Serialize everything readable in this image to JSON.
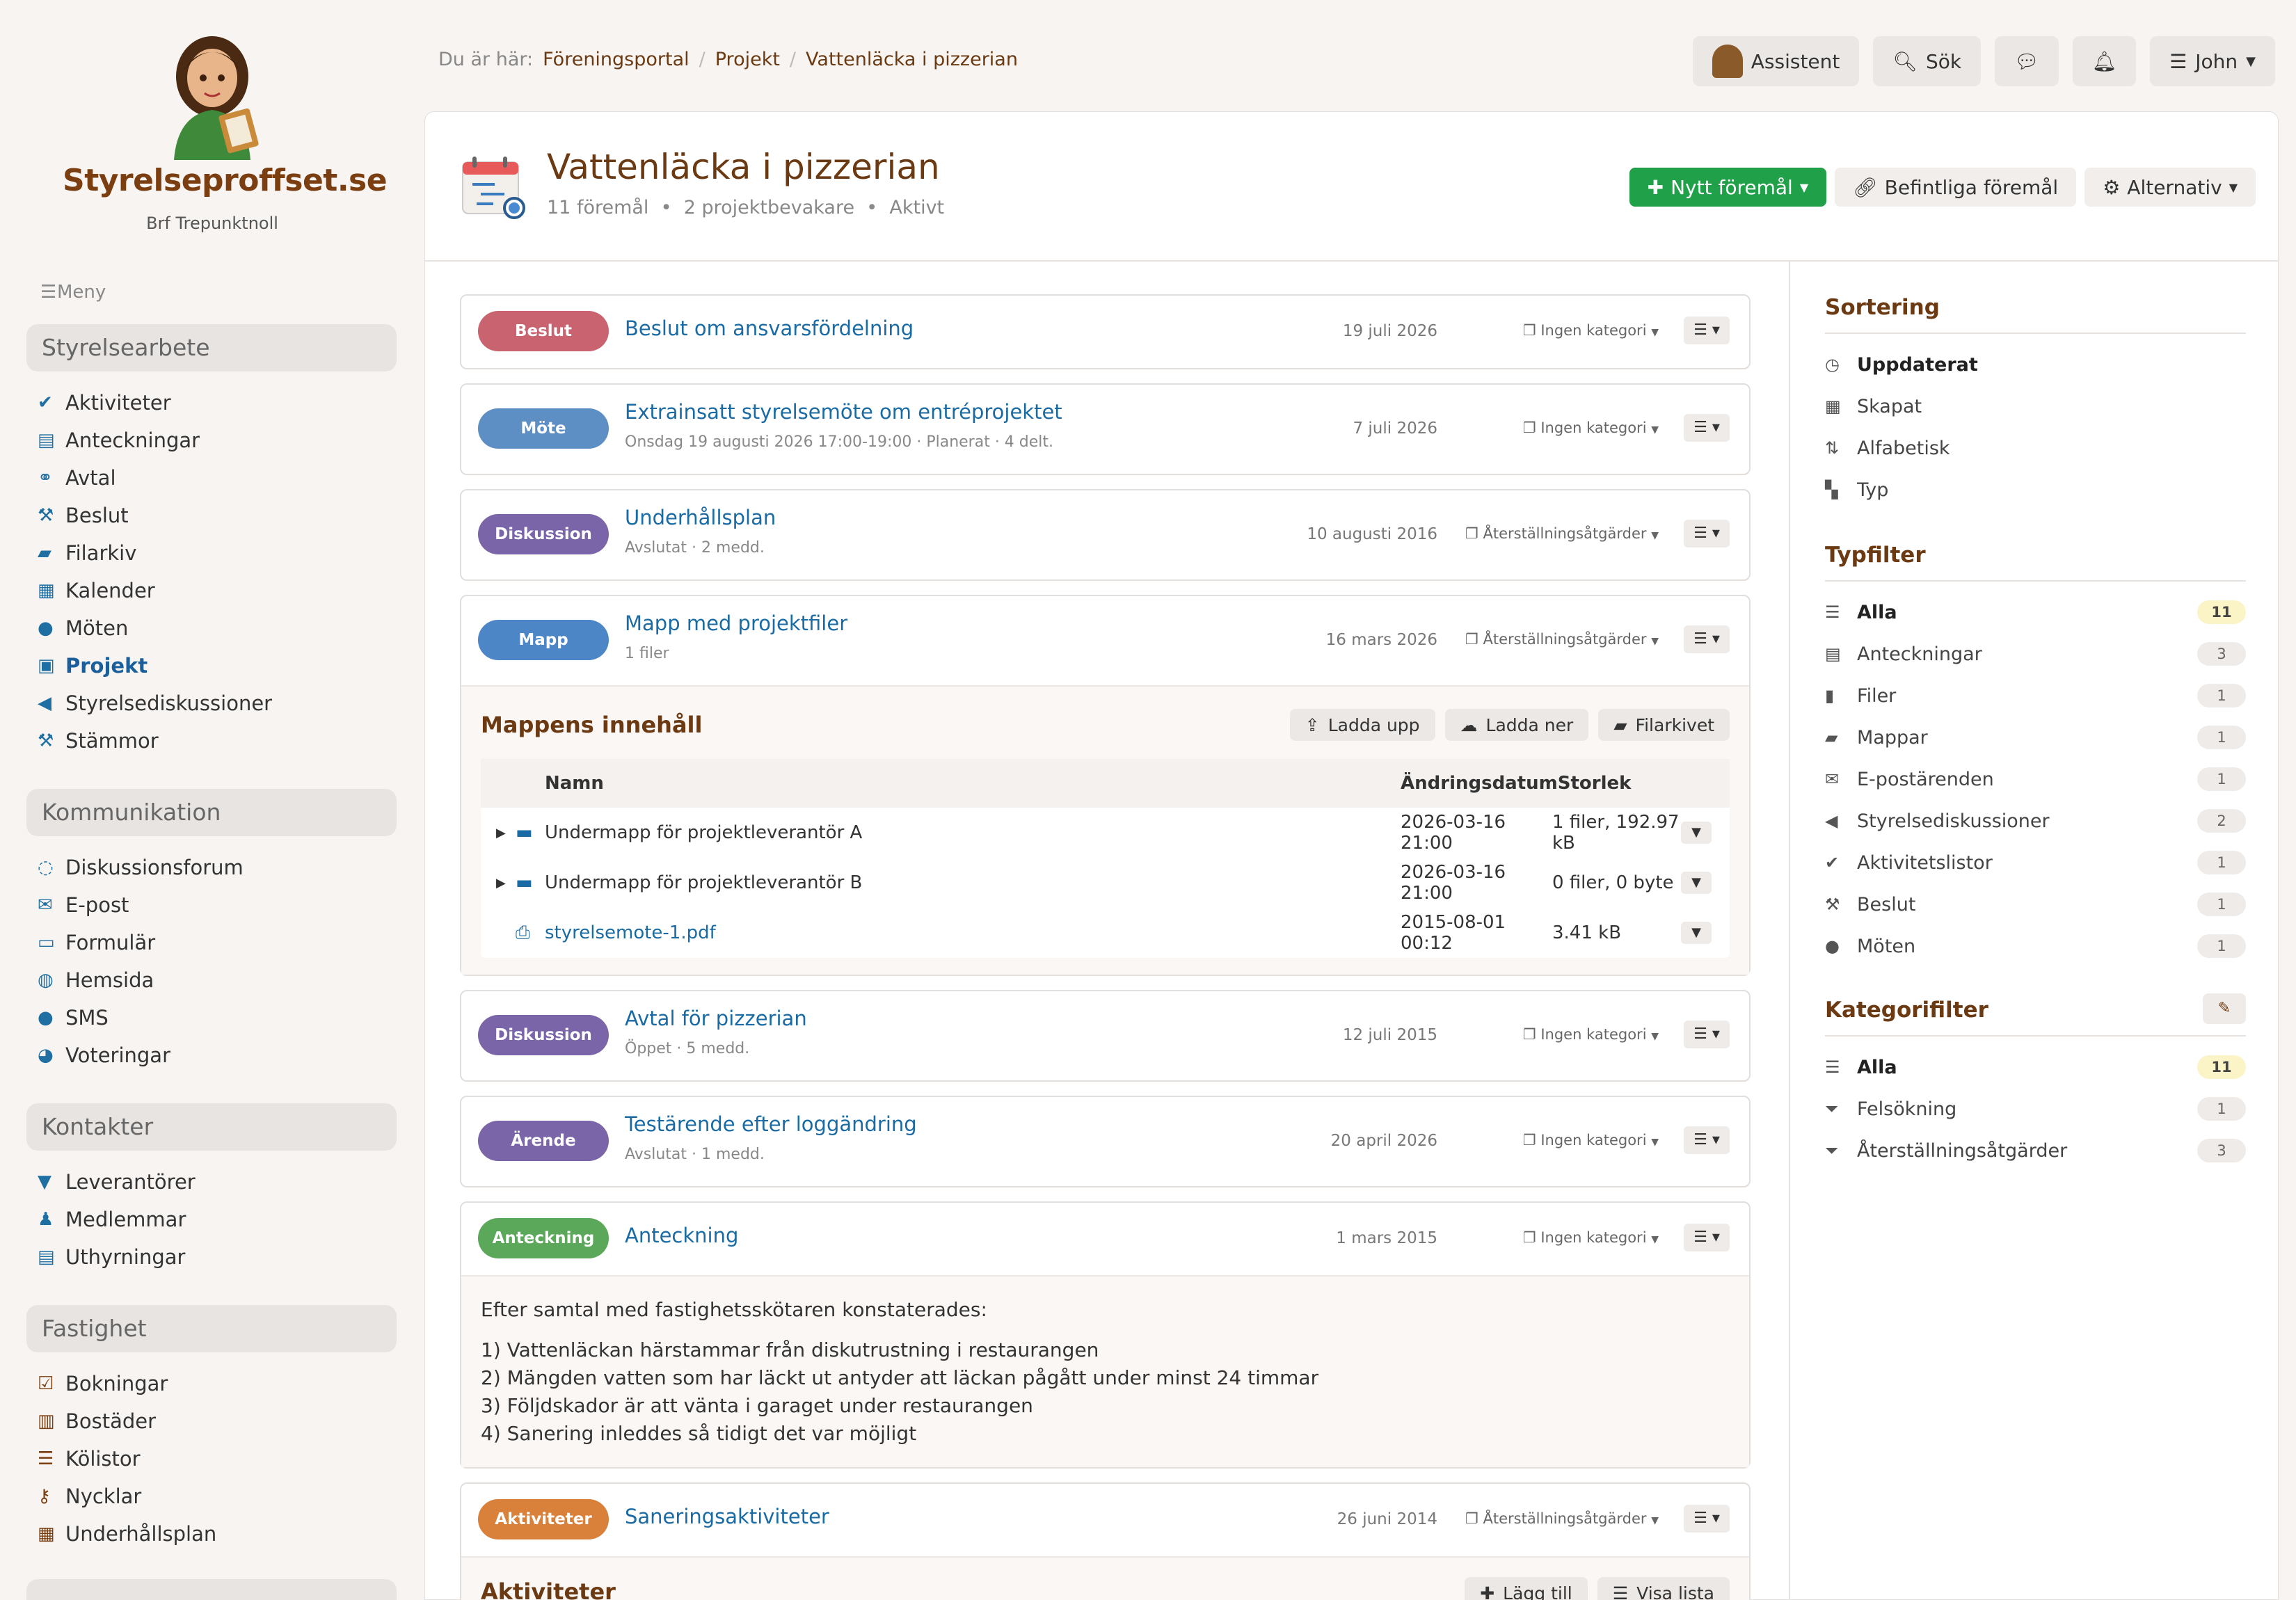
{
  "app": {
    "brand": "Styrelseproffset.se",
    "org": "Brf Trepunktnoll"
  },
  "menu_label": "Meny",
  "sidebar": {
    "groups": [
      {
        "title": "Styrelsearbete",
        "items": [
          {
            "label": "Aktiviteter",
            "icon": "check-icon"
          },
          {
            "label": "Anteckningar",
            "icon": "document-icon"
          },
          {
            "label": "Avtal",
            "icon": "handshake-icon"
          },
          {
            "label": "Beslut",
            "icon": "gavel-icon"
          },
          {
            "label": "Filarkiv",
            "icon": "folder-open-icon"
          },
          {
            "label": "Kalender",
            "icon": "calendar-icon"
          },
          {
            "label": "Möten",
            "icon": "chat-bubble-icon"
          },
          {
            "label": "Projekt",
            "icon": "project-icon"
          },
          {
            "label": "Styrelsediskussioner",
            "icon": "megaphone-icon"
          },
          {
            "label": "Stämmor",
            "icon": "gavel-icon"
          }
        ]
      },
      {
        "title": "Kommunikation",
        "items": [
          {
            "label": "Diskussionsforum",
            "icon": "comments-icon"
          },
          {
            "label": "E-post",
            "icon": "envelope-icon"
          },
          {
            "label": "Formulär",
            "icon": "form-icon"
          },
          {
            "label": "Hemsida",
            "icon": "globe-icon"
          },
          {
            "label": "SMS",
            "icon": "chat-bubble-icon"
          },
          {
            "label": "Voteringar",
            "icon": "pie-chart-icon"
          }
        ]
      },
      {
        "title": "Kontakter",
        "items": [
          {
            "label": "Leverantörer",
            "icon": "cart-icon"
          },
          {
            "label": "Medlemmar",
            "icon": "user-icon"
          },
          {
            "label": "Uthyrningar",
            "icon": "document-icon"
          }
        ]
      },
      {
        "title": "Fastighet",
        "items": [
          {
            "label": "Bokningar",
            "icon": "checkbox-icon"
          },
          {
            "label": "Bostäder",
            "icon": "building-icon"
          },
          {
            "label": "Kölistor",
            "icon": "list-icon"
          },
          {
            "label": "Nycklar",
            "icon": "key-icon"
          },
          {
            "label": "Underhållsplan",
            "icon": "calendar-check-icon"
          }
        ]
      }
    ]
  },
  "breadcrumb": {
    "prefix": "Du är här:",
    "items": [
      "Föreningsportal",
      "Projekt",
      "Vattenläcka i pizzerian"
    ]
  },
  "topbar": {
    "assistant": "Assistent",
    "search": "Sök",
    "user": "John"
  },
  "project": {
    "title": "Vattenläcka i pizzerian",
    "meta": [
      "11 föremål",
      "2 projektbevakare",
      "Aktivt"
    ],
    "btn_new": "Nytt föremål",
    "btn_existing": "Befintliga föremål",
    "btn_options": "Alternativ"
  },
  "colors": {
    "beslut": "#c9636f",
    "mote": "#5d8fc4",
    "diskussion": "#7a65a8",
    "mapp": "#4c86c6",
    "arende": "#7a65a8",
    "anteckning": "#5ba85a",
    "aktiviteter": "#d9813a"
  },
  "feed": [
    {
      "badge": "Beslut",
      "title": "Beslut om ansvarsfördelning",
      "sub": "",
      "date": "19 juli 2026",
      "cat": "Ingen kategori"
    },
    {
      "badge": "Möte",
      "title": "Extrainsatt styrelsemöte om entréprojektet",
      "sub": "Onsdag 19 augusti 2026 17:00-19:00 · Planerat · 4 delt.",
      "date": "7 juli 2026",
      "cat": "Ingen kategori"
    },
    {
      "badge": "Diskussion",
      "title": "Underhållsplan",
      "sub": "Avslutat · 2 medd.",
      "date": "10 augusti 2016",
      "cat": "Återställningsåtgärder"
    },
    {
      "badge": "Mapp",
      "title": "Mapp med projektfiler",
      "sub": "1 filer",
      "date": "16 mars 2026",
      "cat": "Återställningsåtgärder"
    },
    {
      "badge": "Diskussion",
      "title": "Avtal för pizzerian",
      "sub": "Öppet · 5 medd.",
      "date": "12 juli 2015",
      "cat": "Ingen kategori"
    },
    {
      "badge": "Ärende",
      "title": "Testärende efter loggändring",
      "sub": "Avslutat · 1 medd.",
      "date": "20 april 2026",
      "cat": "Ingen kategori"
    },
    {
      "badge": "Anteckning",
      "title": "Anteckning",
      "sub": "",
      "date": "1 mars 2015",
      "cat": "Ingen kategori"
    },
    {
      "badge": "Aktiviteter",
      "title": "Saneringsaktiviteter",
      "sub": "",
      "date": "26 juni 2014",
      "cat": "Återställningsåtgärder"
    }
  ],
  "folder": {
    "title": "Mappens innehåll",
    "btn_upload": "Ladda upp",
    "btn_download": "Ladda ner",
    "btn_archive": "Filarkivet",
    "headers": {
      "name": "Namn",
      "date": "Ändringsdatum",
      "size": "Storlek"
    },
    "rows": [
      {
        "name": "Undermapp för projektleverantör A",
        "date": "2026-03-16 21:00",
        "size": "1 filer, 192.97 kB"
      },
      {
        "name": "Undermapp för projektleverantör B",
        "date": "2026-03-16 21:00",
        "size": "0 filer, 0 byte"
      },
      {
        "name": "styrelsemote-1.pdf",
        "date": "2015-08-01 00:12",
        "size": "3.41 kB"
      }
    ]
  },
  "note": {
    "intro": "Efter samtal med fastighetsskötaren konstaterades:",
    "lines": [
      "1) Vattenläckan härstammar från diskutrustning i restaurangen",
      "2) Mängden vatten som har läckt ut antyder att läckan pågått under minst 24 timmar",
      "3) Följdskador är att vänta i garaget under restaurangen",
      "4) Sanering inleddes så tidigt det var möjligt"
    ]
  },
  "activities": {
    "title": "Aktiviteter",
    "btn_add": "Lägg till",
    "btn_list": "Visa lista"
  },
  "sorting": {
    "title": "Sortering",
    "items": [
      "Uppdaterat",
      "Skapat",
      "Alfabetisk",
      "Typ"
    ]
  },
  "typefilter": {
    "title": "Typfilter",
    "items": [
      {
        "label": "Alla",
        "count": "11"
      },
      {
        "label": "Anteckningar",
        "count": "3"
      },
      {
        "label": "Filer",
        "count": "1"
      },
      {
        "label": "Mappar",
        "count": "1"
      },
      {
        "label": "E-postärenden",
        "count": "1"
      },
      {
        "label": "Styrelsediskussioner",
        "count": "2"
      },
      {
        "label": "Aktivitetslistor",
        "count": "1"
      },
      {
        "label": "Beslut",
        "count": "1"
      },
      {
        "label": "Möten",
        "count": "1"
      }
    ]
  },
  "catfilter": {
    "title": "Kategorifilter",
    "items": [
      {
        "label": "Alla",
        "count": "11"
      },
      {
        "label": "Felsökning",
        "count": "1"
      },
      {
        "label": "Återställningsåtgärder",
        "count": "3"
      }
    ]
  }
}
